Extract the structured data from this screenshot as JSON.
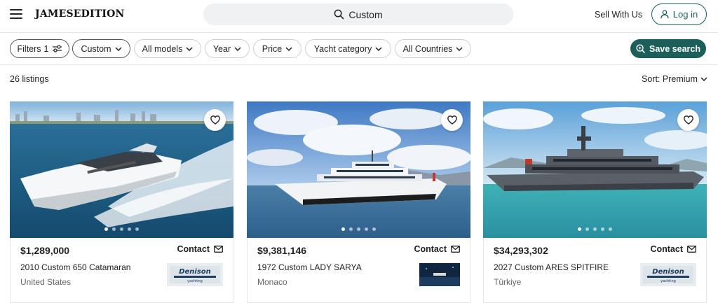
{
  "header": {
    "logo": "JAMESEDITION",
    "search_query": "Custom",
    "sell_label": "Sell With Us",
    "login_label": "Log in"
  },
  "filters": {
    "filters_label": "Filters",
    "filters_count": "1",
    "chips": [
      "Custom",
      "All models",
      "Year",
      "Price",
      "Yacht category",
      "All Countries"
    ],
    "save_label": "Save search"
  },
  "results": {
    "count_label": "26 listings",
    "sort_label": "Sort: Premium"
  },
  "listings": [
    {
      "price": "$1,289,000",
      "contact": "Contact",
      "name": "2010 Custom 650 Catamaran",
      "location": "United States",
      "dealer_logo_text": "Denison yachting",
      "photo_count": 5,
      "active_photo": 1
    },
    {
      "price": "$9,381,146",
      "contact": "Contact",
      "name": "1972 Custom LADY SARYA",
      "location": "Monaco",
      "dealer_logo_text": "",
      "photo_count": 5,
      "active_photo": 1
    },
    {
      "price": "$34,293,302",
      "contact": "Contact",
      "name": "2027 Custom ARES SPITFIRE",
      "location": "Türkiye",
      "dealer_logo_text": "Denison yachting",
      "photo_count": 5,
      "active_photo": 1
    }
  ],
  "colors": {
    "accent": "#1b5e5a",
    "text": "#222222",
    "muted": "#666666",
    "border": "#cfcfcf"
  }
}
